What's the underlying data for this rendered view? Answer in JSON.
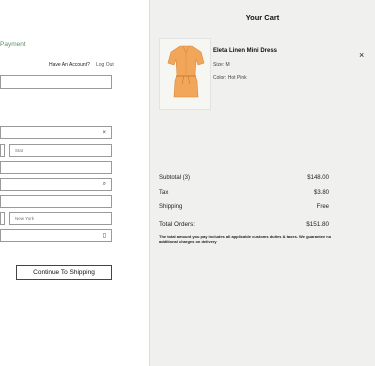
{
  "checkout": {
    "breadcrumb": "Payment",
    "have_account": "Have An Account?",
    "log_out": "Log Out",
    "fields": {
      "state_placeholder": "Stat",
      "city_placeholder": "New York"
    },
    "continue_button": "Continue To Shipping"
  },
  "cart": {
    "title": "Your Cart",
    "item": {
      "name": "Eleta Linen Mini Dress",
      "size": "Size: M",
      "color": "Color: Hot Pink",
      "image_color": "#f2a65a"
    },
    "summary": {
      "subtotal_label": "Subtotal (3)",
      "subtotal_value": "$148.00",
      "tax_label": "Tax",
      "tax_value": "$3.80",
      "shipping_label": "Shipping",
      "shipping_value": "Free",
      "total_label": "Total Orders:",
      "total_value": "$151.80"
    },
    "note": "The total amount you pay includes all applicable customs duties & taxes. We guarantee no additional charges on delivery"
  },
  "icons": {
    "clear": "×",
    "search": "⌕",
    "phone": "▯",
    "remove": "×"
  }
}
